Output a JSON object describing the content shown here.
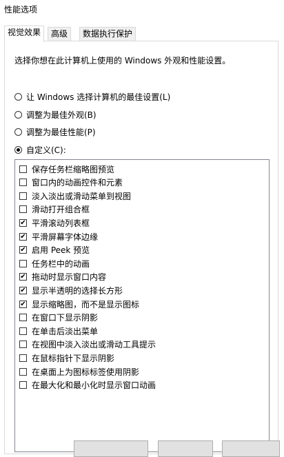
{
  "window": {
    "title": "性能选项"
  },
  "tabs": [
    {
      "label": "视觉效果",
      "active": true
    },
    {
      "label": "高级",
      "active": false
    },
    {
      "label": "数据执行保护",
      "active": false
    }
  ],
  "visual": {
    "description": "选择你想在此计算机上使用的 Windows 外观和性能设置。",
    "options": [
      {
        "label": "让 Windows 选择计算机的最佳设置(L)",
        "checked": false
      },
      {
        "label": "调整为最佳外观(B)",
        "checked": false
      },
      {
        "label": "调整为最佳性能(P)",
        "checked": false
      },
      {
        "label": "自定义(C):",
        "checked": true
      }
    ],
    "items": [
      {
        "label": "保存任务栏缩略图预览",
        "checked": false
      },
      {
        "label": "窗口内的动画控件和元素",
        "checked": false
      },
      {
        "label": "淡入淡出或滑动菜单到视图",
        "checked": false
      },
      {
        "label": "滑动打开组合框",
        "checked": false
      },
      {
        "label": "平滑滚动列表框",
        "checked": true
      },
      {
        "label": "平滑屏幕字体边缘",
        "checked": true
      },
      {
        "label": "启用 Peek 预览",
        "checked": true
      },
      {
        "label": "任务栏中的动画",
        "checked": false
      },
      {
        "label": "拖动时显示窗口内容",
        "checked": true
      },
      {
        "label": "显示半透明的选择长方形",
        "checked": true
      },
      {
        "label": "显示缩略图，而不是显示图标",
        "checked": true
      },
      {
        "label": "在窗口下显示阴影",
        "checked": false
      },
      {
        "label": "在单击后淡出菜单",
        "checked": false
      },
      {
        "label": "在视图中淡入淡出或滑动工具提示",
        "checked": false
      },
      {
        "label": "在鼠标指针下显示阴影",
        "checked": false
      },
      {
        "label": "在桌面上为图标标签使用阴影",
        "checked": false
      },
      {
        "label": "在最大化和最小化时显示窗口动画",
        "checked": false
      }
    ]
  },
  "colors": {
    "border": "#d9d9d9",
    "list_border": "#828790"
  }
}
